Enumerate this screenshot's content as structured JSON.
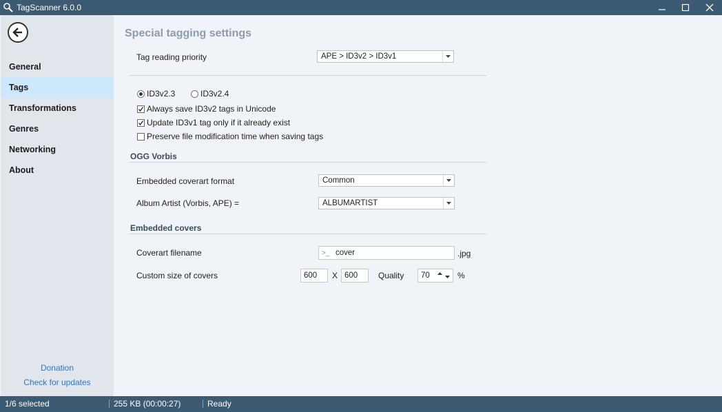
{
  "window": {
    "title": "TagScanner 6.0.0",
    "icon": "magnifier-icon"
  },
  "sidebar": {
    "items": [
      {
        "label": "General",
        "active": false
      },
      {
        "label": "Tags",
        "active": true
      },
      {
        "label": "Transformations",
        "active": false
      },
      {
        "label": "Genres",
        "active": false
      },
      {
        "label": "Networking",
        "active": false
      },
      {
        "label": "About",
        "active": false
      }
    ],
    "donation": "Donation",
    "check_updates": "Check for updates"
  },
  "main": {
    "title": "Special tagging settings",
    "tag_reading_priority": {
      "label": "Tag reading priority",
      "value": "APE > ID3v2 > ID3v1"
    },
    "id3_version": {
      "option1": "ID3v2.3",
      "option2": "ID3v2.4",
      "selected": "ID3v2.3"
    },
    "checkboxes": [
      {
        "label": "Always save ID3v2 tags in Unicode",
        "checked": true
      },
      {
        "label": "Update ID3v1 tag only if it already exist",
        "checked": true
      },
      {
        "label": "Preserve file modification time when saving tags",
        "checked": false
      }
    ],
    "ogg_section": {
      "title": "OGG Vorbis",
      "coverart_format": {
        "label": "Embedded coverart format",
        "value": "Common"
      },
      "album_artist": {
        "label": "Album Artist (Vorbis, APE) =",
        "value": "ALBUMARTIST"
      }
    },
    "covers_section": {
      "title": "Embedded covers",
      "filename": {
        "label": "Coverart filename",
        "prefix": ">_",
        "value": "cover",
        "suffix": ".jpg"
      },
      "size": {
        "label": "Custom size of covers",
        "width": "600",
        "x": "X",
        "height": "600"
      },
      "quality": {
        "label": "Quality",
        "value": "70",
        "unit": "%"
      }
    }
  },
  "status": {
    "selected": "1/6 selected",
    "size": "255 KB (00:00:27)",
    "state": "Ready"
  },
  "colors": {
    "titlebar": "#3d5a73",
    "sidebar": "#e1e6ec",
    "active_item": "#cde8fb",
    "link": "#2a78c2",
    "main_bg": "#f0f3f7"
  }
}
